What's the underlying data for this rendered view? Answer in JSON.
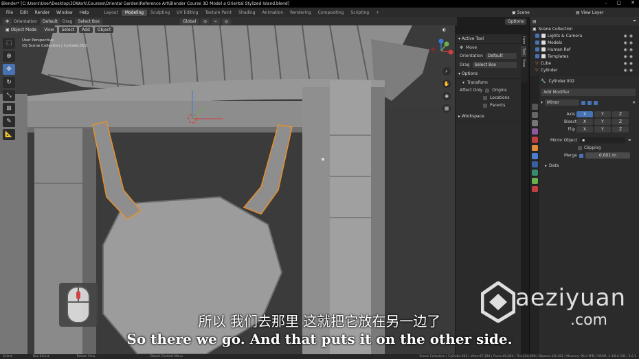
{
  "titlebar": {
    "title": "Blender* [C:\\Users\\User\\Desktop\\3DWork\\Courses\\Oriental Garden\\Reference Art\\Blender Course 3D Model a Oriental Stylized Island.blend]",
    "minimize": "–",
    "maximize": "▢",
    "close": "✕"
  },
  "menubar": {
    "menus": [
      "File",
      "Edit",
      "Render",
      "Window",
      "Help"
    ],
    "workspaces": [
      "Layout",
      "Modeling",
      "Sculpting",
      "UV Editing",
      "Texture Paint",
      "Shading",
      "Animation",
      "Rendering",
      "Compositing",
      "Scripting"
    ],
    "active_workspace": "Modeling",
    "add_workspace": "+",
    "scene_label": "Scene",
    "view_layer_label": "View Layer"
  },
  "toolheader": {
    "orientation_label": "Orientation",
    "orientation_value": "Default",
    "drag_label": "Drag",
    "drag_value": "Select Box",
    "transform_orientation": "Global",
    "options_label": "Options"
  },
  "viewheader": {
    "mode": "Object Mode",
    "menus": [
      "View",
      "Select",
      "Add",
      "Object"
    ]
  },
  "viewport": {
    "perspective_label": "User Perspective",
    "collection_label": "(0) Scene Collection | Cylinder.002"
  },
  "npanel": {
    "active_tool_title": "Active Tool",
    "tool_name": "Move",
    "orientation_label": "Orientation",
    "orientation_value": "Default",
    "drag_label": "Drag",
    "drag_value": "Select Box",
    "options_title": "Options",
    "transform_title": "Transform",
    "affect_only_label": "Affect Only",
    "affect_items": [
      "Origins",
      "Locations",
      "Parents"
    ],
    "workspace_title": "Workspace",
    "tabs": [
      "Item",
      "Tool",
      "View"
    ]
  },
  "outliner": {
    "root": "Scene Collection",
    "items": [
      {
        "name": "Lights & Camera",
        "color": "#e0a050"
      },
      {
        "name": "Models",
        "color": "#e0a050"
      },
      {
        "name": "Human Ref",
        "color": "#e0a050"
      },
      {
        "name": "Templates",
        "color": "#e0a050"
      },
      {
        "name": "Cube",
        "color": "#e08a3a"
      },
      {
        "name": "Cylinder",
        "color": "#e08a3a"
      }
    ]
  },
  "properties": {
    "object_name": "Cylinder.002",
    "add_modifier": "Add Modifier",
    "modifier_name": "Mirror",
    "axis_label": "Axis",
    "bisect_label": "Bisect",
    "flip_label": "Flip",
    "axes": [
      "X",
      "Y",
      "Z"
    ],
    "mirror_object_label": "Mirror Object",
    "clipping_label": "Clipping",
    "merge_label": "Merge",
    "merge_value": "0.001 m",
    "data_label": "Data"
  },
  "statusbar": {
    "left_items": [
      "Select",
      "Box Select",
      "Rotate View",
      "Object Context Menu"
    ],
    "right_text": "Scene Collection | Cylinder.002 | Verts:67,184 | Faces:65,824 | Tris:124,590 | Objects:1/8,181 | Memory: 96.4 MiB | VRAM: 1.3/8.0 GiB | 3.0.1"
  },
  "subtitles": {
    "chinese": "所以 我们去那里 这就把它放在另一边了",
    "english": "So there we go. And that puts it on the other side."
  },
  "watermark": {
    "name": "aeziyuan",
    "suffix": ".com"
  },
  "colors": {
    "accent": "#4772b3",
    "selection": "#e8902c",
    "viewport_bg": "#393939"
  }
}
